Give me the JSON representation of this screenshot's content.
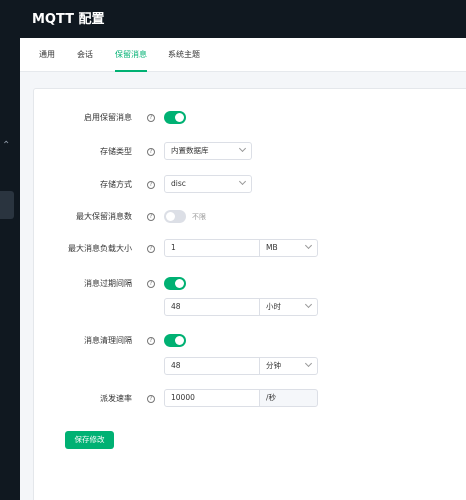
{
  "app": {
    "title": "MQTT 配置"
  },
  "tabs": [
    {
      "label": "通用"
    },
    {
      "label": "会话"
    },
    {
      "label": "保留消息",
      "active": true
    },
    {
      "label": "系统主题"
    }
  ],
  "form": {
    "enable_retain": {
      "label": "启用保留消息",
      "on": true
    },
    "storage_type": {
      "label": "存储类型",
      "value": "内置数据库"
    },
    "storage_method": {
      "label": "存储方式",
      "value": "disc"
    },
    "max_retained": {
      "label": "最大保留消息数",
      "on": false,
      "switch_text": "不限"
    },
    "max_payload": {
      "label": "最大消息负载大小",
      "value": "1",
      "unit": "MB"
    },
    "expiry": {
      "label": "消息过期间隔",
      "on": true,
      "value": "48",
      "unit": "小时"
    },
    "clean": {
      "label": "消息清理间隔",
      "on": true,
      "value": "48",
      "unit": "分钟"
    },
    "rate": {
      "label": "派发速率",
      "value": "10000",
      "unit": "/秒"
    }
  },
  "save_label": "保存修改",
  "icons": {
    "help": "question-circle-icon",
    "chevron": "chevron-down-icon",
    "sidebar": "chevron-up-icon"
  },
  "colors": {
    "accent": "#00b173",
    "sidebar": "#101820",
    "page_bg": "#f4f6f9"
  }
}
